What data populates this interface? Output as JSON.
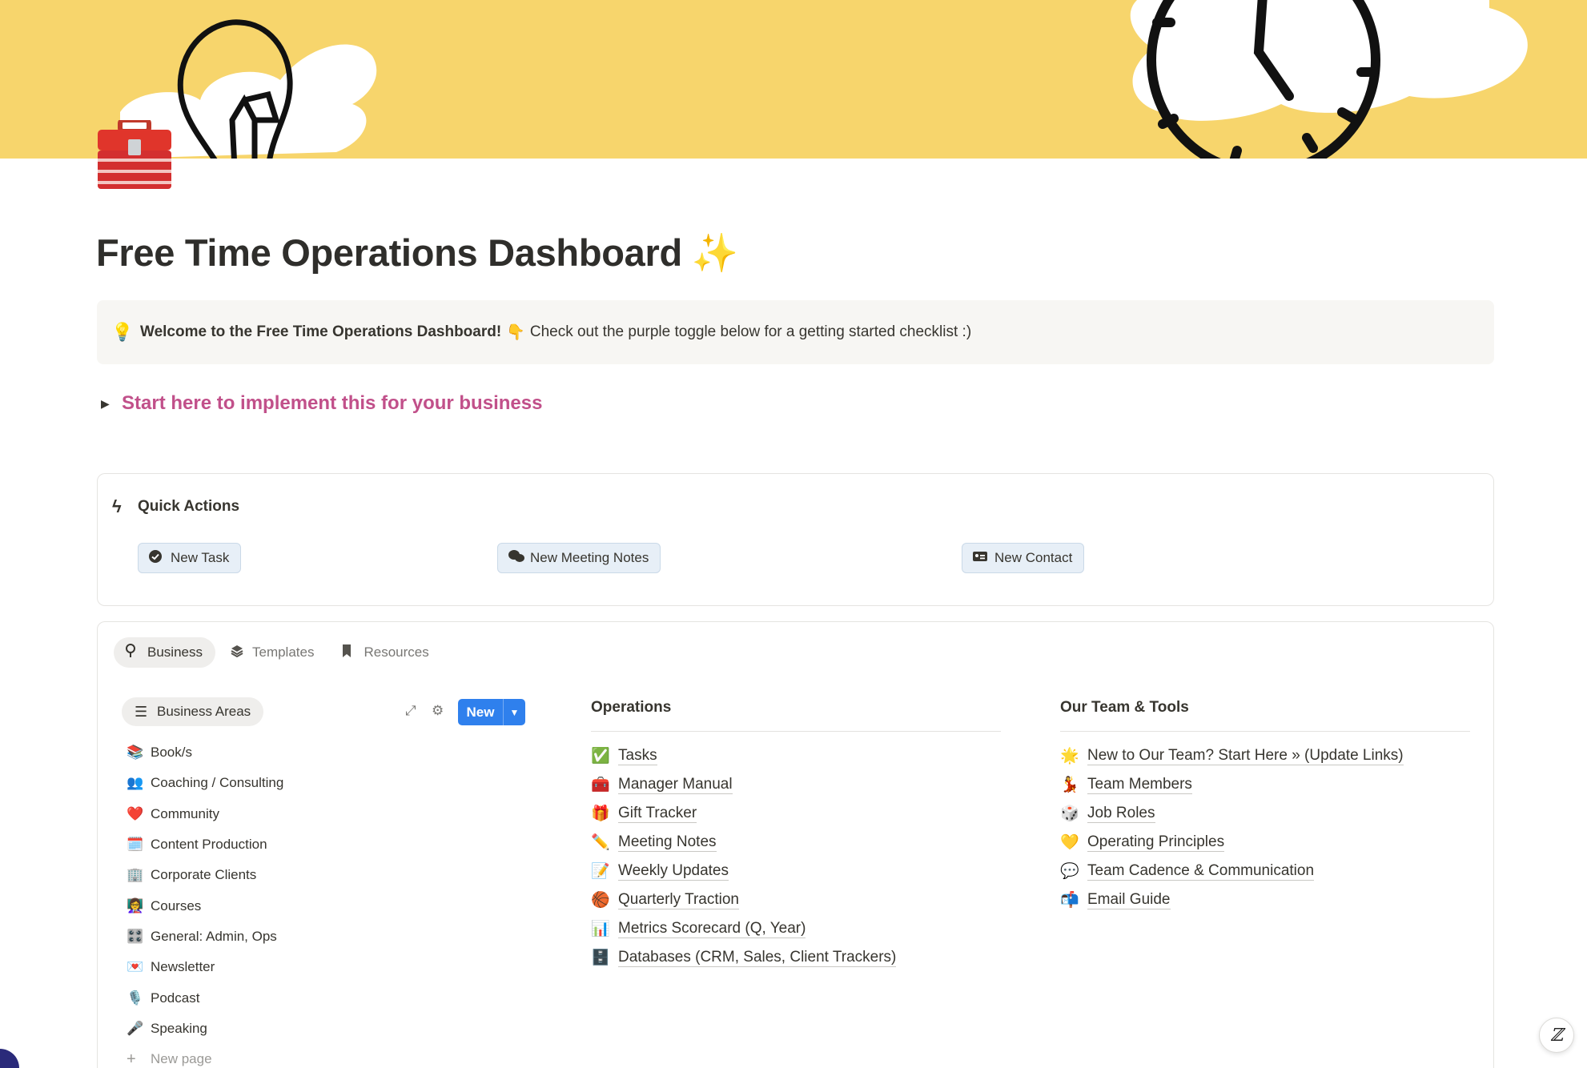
{
  "page": {
    "title": "Free Time Operations Dashboard",
    "title_emoji": "✨",
    "page_icon": "toolbox-icon"
  },
  "callout": {
    "icon": "💡",
    "bold_text": "Welcome to the Free Time Operations Dashboard!",
    "hand": "👇",
    "text": "Check out the purple toggle below for a getting started checklist :)"
  },
  "toggle": {
    "label": "Start here to implement this for your business",
    "color": "#c1508a"
  },
  "quick_actions": {
    "heading": "Quick Actions",
    "buttons": [
      {
        "label": "New Task",
        "icon": "check-circle-icon"
      },
      {
        "label": "New Meeting Notes",
        "icon": "chat-bubbles-icon"
      },
      {
        "label": "New Contact",
        "icon": "contact-card-icon"
      }
    ]
  },
  "tabs": [
    {
      "label": "Business",
      "icon": "pin-icon",
      "active": true
    },
    {
      "label": "Templates",
      "icon": "layers-icon",
      "active": false
    },
    {
      "label": "Resources",
      "icon": "bookmark-icon",
      "active": false
    }
  ],
  "business_areas": {
    "view_label": "Business Areas",
    "new_label": "New",
    "items": [
      {
        "emoji": "📚",
        "label": "Book/s"
      },
      {
        "emoji": "👥",
        "label": "Coaching / Consulting"
      },
      {
        "emoji": "❤️",
        "label": "Community"
      },
      {
        "emoji": "🗓️",
        "label": "Content Production"
      },
      {
        "emoji": "🏢",
        "label": "Corporate Clients"
      },
      {
        "emoji": "👩‍🏫",
        "label": "Courses"
      },
      {
        "emoji": "🎛️",
        "label": "General: Admin, Ops"
      },
      {
        "emoji": "💌",
        "label": "Newsletter"
      },
      {
        "emoji": "🎙️",
        "label": "Podcast"
      },
      {
        "emoji": "🎤",
        "label": "Speaking"
      }
    ],
    "new_page_label": "New page"
  },
  "operations": {
    "heading": "Operations",
    "links": [
      {
        "emoji": "✅",
        "label": "Tasks"
      },
      {
        "emoji": "🧰",
        "label": "Manager Manual"
      },
      {
        "emoji": "🎁",
        "label": "Gift Tracker"
      },
      {
        "emoji": "✏️",
        "label": "Meeting Notes"
      },
      {
        "emoji": "📝",
        "label": "Weekly Updates"
      },
      {
        "emoji": "🏀",
        "label": "Quarterly Traction"
      },
      {
        "emoji": "📊",
        "label": "Metrics Scorecard (Q, Year)"
      },
      {
        "emoji": "🗄️",
        "label": "Databases (CRM, Sales, Client Trackers)"
      }
    ]
  },
  "team": {
    "heading": "Our Team & Tools",
    "links": [
      {
        "emoji": "🌟",
        "label": "New to Our Team? Start Here » (Update Links)"
      },
      {
        "emoji": "💃",
        "label": "Team Members"
      },
      {
        "emoji": "🎲",
        "label": "Job Roles"
      },
      {
        "emoji": "💛",
        "label": "Operating Principles"
      },
      {
        "emoji": "💬",
        "label": "Team Cadence & Communication"
      },
      {
        "emoji": "📬",
        "label": "Email Guide"
      }
    ]
  },
  "colors": {
    "cover": "#f7d56c",
    "accent_blue": "#2f80ed",
    "toggle_pink": "#c1508a"
  }
}
